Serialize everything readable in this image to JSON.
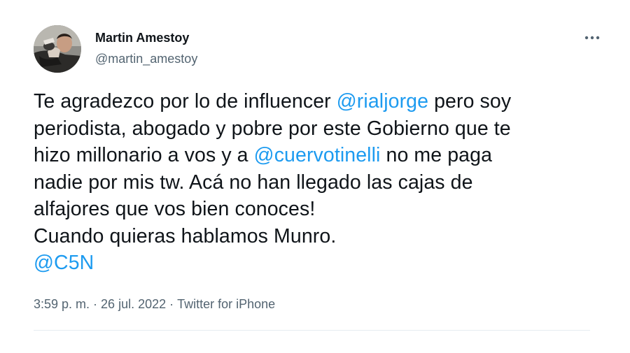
{
  "author": {
    "name": "Martin Amestoy",
    "handle": "@martin_amestoy"
  },
  "tweet": {
    "lines": [
      {
        "pre": "Te agradezco por lo de influencer ",
        "mention": "@rialjorge",
        "post": " pero soy"
      },
      {
        "pre": "periodista, abogado y pobre por este Gobierno que te",
        "mention": "",
        "post": ""
      },
      {
        "pre": "hizo millonario a vos y a ",
        "mention": "@cuervotinelli",
        "post": " no me paga"
      },
      {
        "pre": "nadie por mis tw. Acá no han llegado las cajas de",
        "mention": "",
        "post": ""
      },
      {
        "pre": "alfajores que vos bien conoces!",
        "mention": "",
        "post": ""
      },
      {
        "pre": "Cuando quieras hablamos Munro.",
        "mention": "",
        "post": ""
      },
      {
        "pre": "",
        "mention": "@C5N",
        "post": ""
      }
    ]
  },
  "meta": {
    "time": "3:59 p. m.",
    "separator": "·",
    "date": "26 jul. 2022",
    "source": "Twitter for iPhone"
  },
  "icons": {
    "more": "more-options-icon"
  },
  "colors": {
    "text": "#0f1419",
    "secondary": "#536471",
    "link": "#1d9bf0",
    "divider": "#e6ecf0"
  }
}
